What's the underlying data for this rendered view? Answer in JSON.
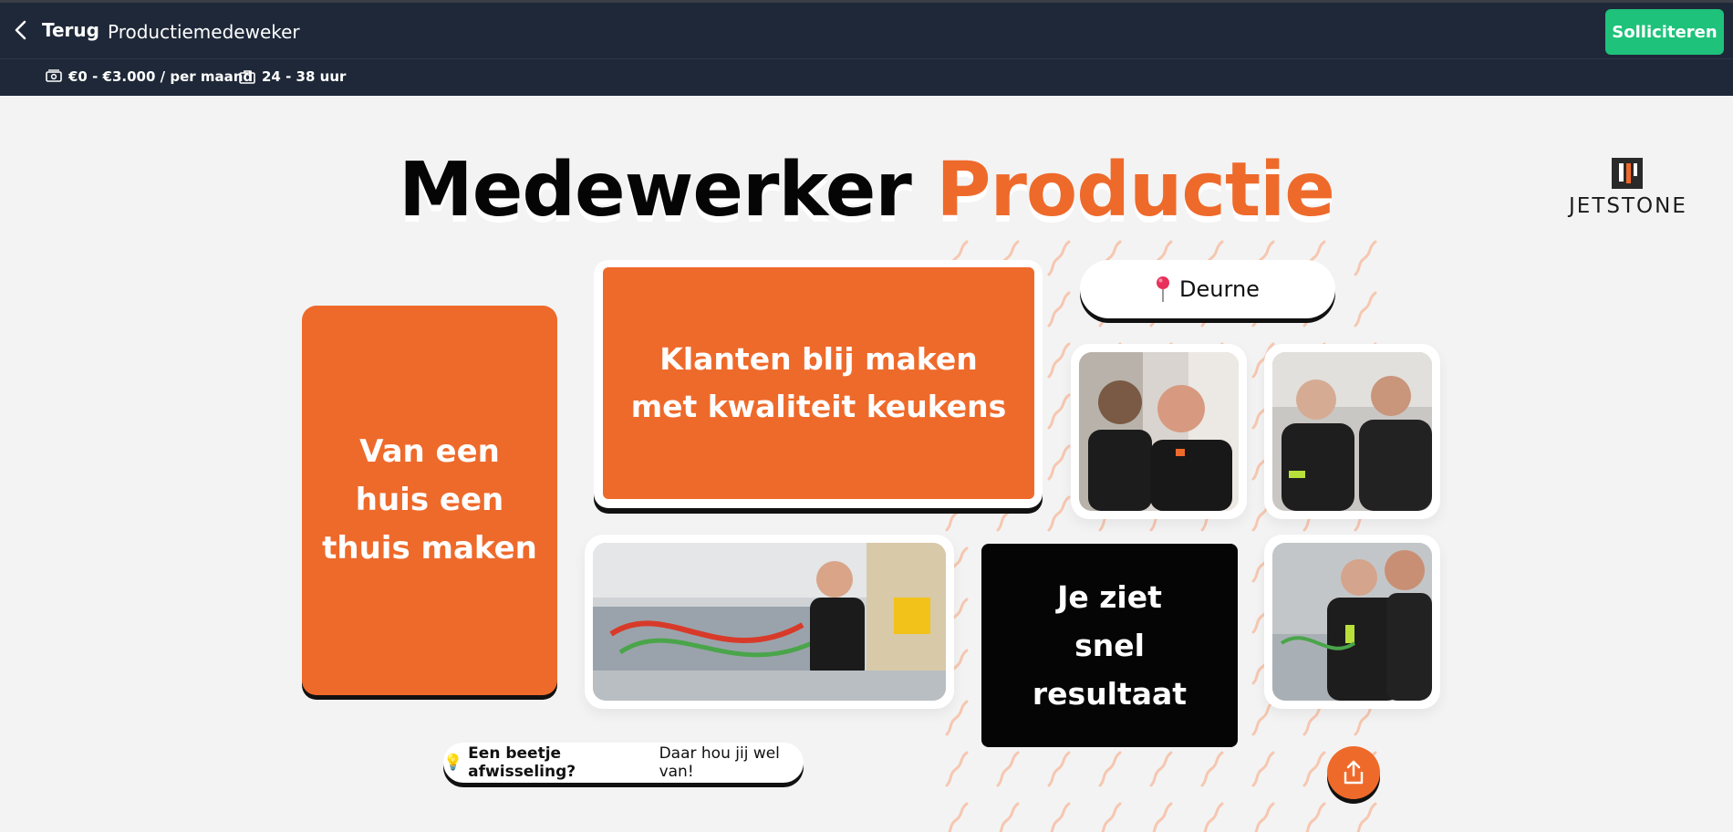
{
  "topbar": {
    "back_label": "Terug",
    "job_title": "Productiemedeweker",
    "apply_label": "Solliciteren"
  },
  "meta": {
    "salary": "€0 - €3.000 / per maand",
    "hours": "24 - 38 uur"
  },
  "hero": {
    "headline_part1": "Medewerker",
    "headline_part2": "Productie",
    "logo_text": "JETSTONE",
    "location": "Deurne",
    "card_huis": "Van een huis een thuis maken",
    "card_klanten": "Klanten blij maken met kwaliteit keukens",
    "card_resultaat": "Je ziet snel resultaat",
    "tip_bold": "Een beetje afwisseling?",
    "tip_rest": "Daar hou jij wel van!"
  },
  "colors": {
    "brand_orange": "#ee6a2b",
    "apply_green": "#1ec27a",
    "topbar_navy": "#1e2838"
  },
  "icons": {
    "back": "chevron-left-icon",
    "salary": "money-icon",
    "hours": "briefcase-icon",
    "location": "pushpin-icon",
    "tip": "lightbulb-icon",
    "share": "share-icon"
  }
}
